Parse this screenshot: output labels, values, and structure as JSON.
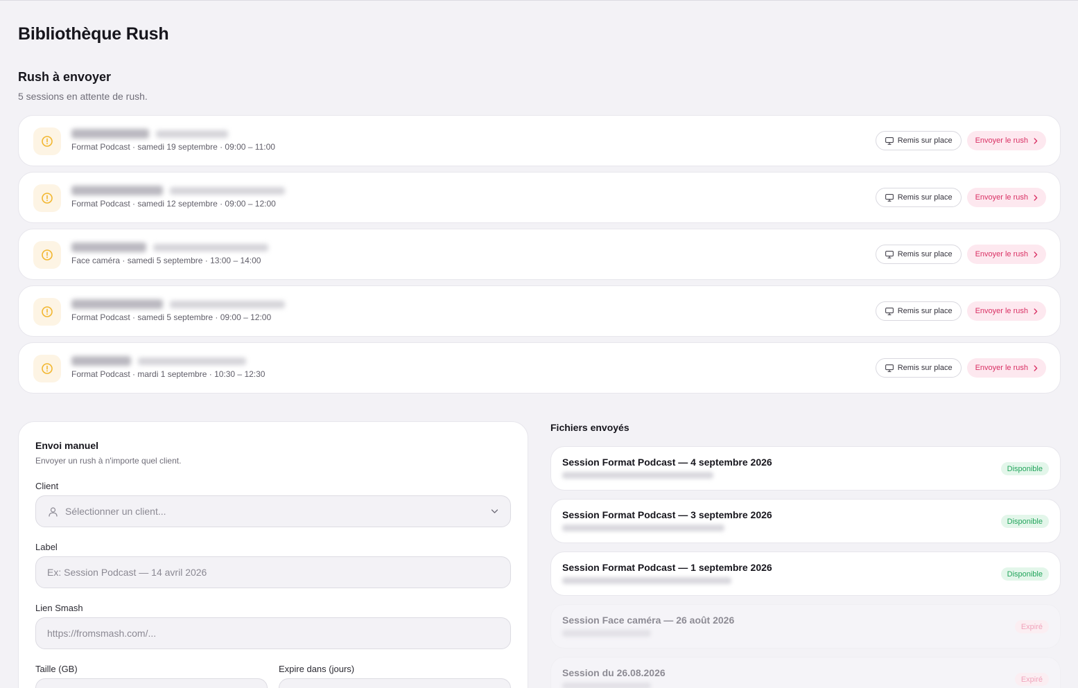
{
  "page": {
    "title": "Bibliothèque Rush"
  },
  "pending": {
    "title": "Rush à envoyer",
    "subtitle": "5 sessions en attente de rush.",
    "onsite_label": "Remis sur place",
    "send_label": "Envoyer le rush",
    "rows": [
      {
        "meta": "Format Podcast · samedi 19 septembre · 09:00 – 11:00"
      },
      {
        "meta": "Format Podcast · samedi 12 septembre · 09:00 – 12:00"
      },
      {
        "meta": "Face caméra · samedi 5 septembre · 13:00 – 14:00"
      },
      {
        "meta": "Format Podcast · samedi 5 septembre · 09:00 – 12:00"
      },
      {
        "meta": "Format Podcast · mardi 1 septembre · 10:30 – 12:30"
      }
    ]
  },
  "manual": {
    "title": "Envoi manuel",
    "subtitle": "Envoyer un rush à n'importe quel client.",
    "client_label": "Client",
    "client_placeholder": "Sélectionner un client...",
    "label_label": "Label",
    "label_placeholder": "Ex: Session Podcast — 14 avril 2026",
    "link_label": "Lien Smash",
    "link_placeholder": "https://fromsmash.com/...",
    "size_label": "Taille (GB)",
    "expire_label": "Expire dans (jours)"
  },
  "sent": {
    "title": "Fichiers envoyés",
    "items": [
      {
        "name": "Session Format Podcast — 4 septembre 2026",
        "status": "Disponible"
      },
      {
        "name": "Session Format Podcast — 3 septembre 2026",
        "status": "Disponible"
      },
      {
        "name": "Session Format Podcast — 1 septembre 2026",
        "status": "Disponible"
      },
      {
        "name": "Session Face caméra — 26 août 2026",
        "status": "Expiré"
      },
      {
        "name": "Session du 26.08.2026",
        "status": "Expiré"
      }
    ]
  },
  "colors": {
    "accent": "#d92f63",
    "accent_bg": "#fde8ef",
    "warning": "#f2b62e",
    "available": "#21a45b",
    "background": "#f3f2f6"
  },
  "icons": {
    "row_status": "alert-circle-icon",
    "onsite": "monitor-icon",
    "send": "chevron-right-icon",
    "client": "user-icon",
    "client_dropdown": "chevron-down-icon"
  }
}
